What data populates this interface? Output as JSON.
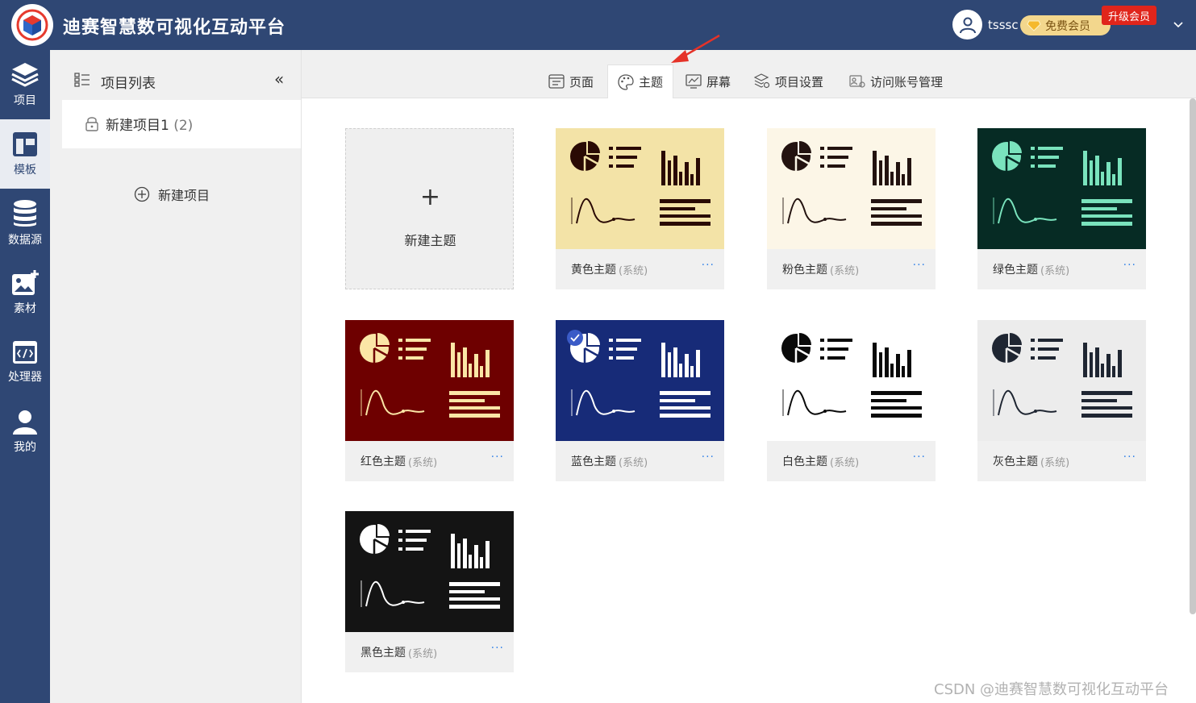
{
  "app": {
    "title": "迪赛智慧数可视化互动平台"
  },
  "header": {
    "username": "tsssc",
    "member_label": "免费会员",
    "upgrade_label": "升级会员"
  },
  "nav": [
    {
      "label": "项目",
      "icon": "stack-icon"
    },
    {
      "label": "模板",
      "icon": "template-icon"
    },
    {
      "label": "数据源",
      "icon": "database-icon"
    },
    {
      "label": "素材",
      "icon": "image-add-icon"
    },
    {
      "label": "处理器",
      "icon": "code-icon"
    },
    {
      "label": "我的",
      "icon": "user-icon"
    }
  ],
  "projects": {
    "title": "项目列表",
    "collapse": "«",
    "items": [
      {
        "name": "新建项目1",
        "count": "(2)"
      }
    ],
    "new_label": "新建项目"
  },
  "tabs": [
    {
      "label": "页面",
      "icon": "page-icon"
    },
    {
      "label": "主题",
      "icon": "palette-icon",
      "active": true
    },
    {
      "label": "屏幕",
      "icon": "screen-icon"
    },
    {
      "label": "项目设置",
      "icon": "settings-icon"
    },
    {
      "label": "访问账号管理",
      "icon": "account-icon"
    }
  ],
  "new_theme": {
    "plus": "+",
    "label": "新建主题"
  },
  "themes": [
    {
      "name": "黄色主题",
      "tag": "(系统)",
      "bg": "#f3e3a7",
      "fg": "#2a0a04",
      "selected": false
    },
    {
      "name": "粉色主题",
      "tag": "(系统)",
      "bg": "#fcf6e7",
      "fg": "#231310",
      "selected": false
    },
    {
      "name": "绿色主题",
      "tag": "(系统)",
      "bg": "#062b24",
      "fg": "#7ae3bd",
      "selected": false
    },
    {
      "name": "红色主题",
      "tag": "(系统)",
      "bg": "#6e0000",
      "fg": "#fbe6a6",
      "selected": false
    },
    {
      "name": "蓝色主题",
      "tag": "(系统)",
      "bg": "#172b78",
      "fg": "#ffffff",
      "selected": true
    },
    {
      "name": "白色主题",
      "tag": "(系统)",
      "bg": "#ffffff",
      "fg": "#0a0a0a",
      "selected": false
    },
    {
      "name": "灰色主题",
      "tag": "(系统)",
      "bg": "#ececec",
      "fg": "#1f2632",
      "selected": false
    },
    {
      "name": "黑色主题",
      "tag": "(系统)",
      "bg": "#141414",
      "fg": "#ffffff",
      "selected": false
    }
  ],
  "more": "···",
  "watermark": "CSDN @迪赛智慧数可视化互动平台"
}
